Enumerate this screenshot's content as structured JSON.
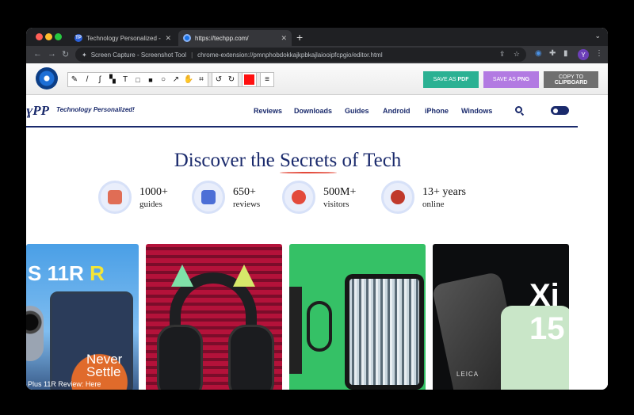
{
  "browser": {
    "tabs": [
      {
        "label": "Technology Personalized - Tec",
        "favicon": "techpp-favicon",
        "active": false
      },
      {
        "label": "https://techpp.com/",
        "favicon": "loading-favicon",
        "active": true
      }
    ],
    "close_glyph": "✕",
    "new_tab_glyph": "+",
    "tab_menu_glyph": "⌄",
    "address": {
      "site_label": "Screen Capture - Screenshot Tool",
      "url": "chrome-extension://pmnphobdokkajkpbkajlaiooipfcpgio/editor.html"
    },
    "profile_initial": "Y"
  },
  "toolbar": {
    "tools": [
      "pencil-icon",
      "line-icon",
      "curve-icon",
      "highlight-icon",
      "text-icon",
      "rectangle-icon",
      "filled-rect-icon",
      "circle-icon",
      "arrow-icon",
      "hand-icon",
      "crop-icon"
    ],
    "tool_glyphs": [
      "✎",
      "/",
      "∫",
      "▚",
      "T",
      "□",
      "■",
      "○",
      "↗",
      "✋",
      "⌗"
    ],
    "undo_glyph": "↺",
    "redo_glyph": "↻",
    "menu_glyph": "≡",
    "selected_color": "#ff1010",
    "save_pdf_prefix": "SAVE AS ",
    "save_pdf_suffix": "PDF",
    "save_png_prefix": "SAVE AS ",
    "save_png_suffix": "PNG",
    "copy_line1": "COPY TO",
    "copy_line2": "CLIPBOARD",
    "pdf_color": "#2bb193",
    "png_color": "#b27ae2",
    "copy_color": "#6f6f6f"
  },
  "site": {
    "logo": "ɣPP",
    "tagline": "Technology Personalized!",
    "nav": [
      "Reviews",
      "Downloads",
      "Guides",
      "Android",
      "iPhone",
      "Windows"
    ],
    "hero_before": "Discover the ",
    "hero_highlight": "Secrets",
    "hero_after": " of Tech",
    "stats": [
      {
        "number": "1000+",
        "label": "guides",
        "icon": "guides-icon",
        "icon_color": "#e06d55"
      },
      {
        "number": "650+",
        "label": "reviews",
        "icon": "reviews-icon",
        "icon_color": "#4d6fd6"
      },
      {
        "number": "500M+",
        "label": "visitors",
        "icon": "visitors-icon",
        "icon_color": "#e34a3b"
      },
      {
        "number": "13+ years",
        "label": "online",
        "icon": "award-icon",
        "icon_color": "#c0392b"
      }
    ],
    "cards": [
      {
        "title_white": "S 11R ",
        "title_yellow": "R",
        "overlay": "Never Settle",
        "caption": "Plus 11R Review: Here"
      },
      {
        "title": ""
      },
      {
        "title": ""
      },
      {
        "overlay_line1": "Xi",
        "overlay_line2": "15",
        "brand": "LEICA"
      }
    ]
  }
}
